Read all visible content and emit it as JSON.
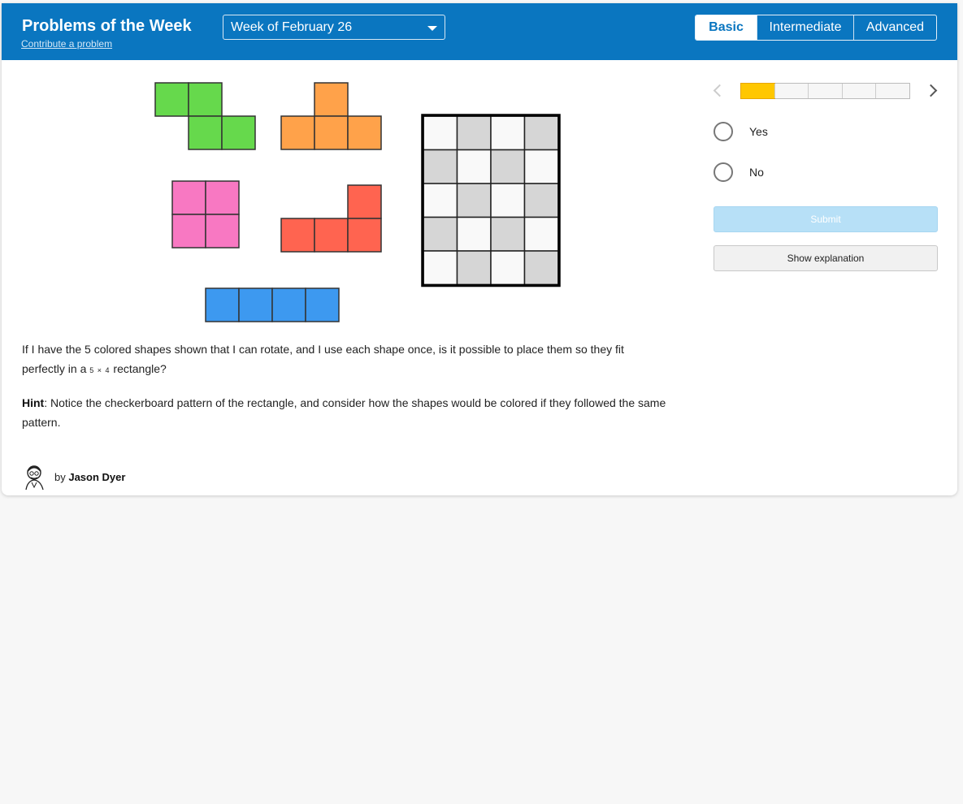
{
  "header": {
    "title": "Problems of the Week",
    "contribute_link": "Contribute a problem",
    "week_select": "Week of February 26",
    "levels": [
      {
        "label": "Basic",
        "active": true
      },
      {
        "label": "Intermediate",
        "active": false
      },
      {
        "label": "Advanced",
        "active": false
      }
    ]
  },
  "colors": {
    "header_bg": "#0a76c0",
    "green": "#66d94c",
    "orange": "#ffa24a",
    "pink": "#f878c2",
    "red": "#ff6450",
    "blue": "#3d99f0",
    "progress": "#ffc700"
  },
  "figure": {
    "shapes": [
      "green-s-tetromino",
      "orange-t-tetromino",
      "pink-square-tetromino",
      "red-l-tetromino",
      "blue-i-tetromino"
    ],
    "board": {
      "rows": 5,
      "cols": 4,
      "pattern": "checkerboard"
    }
  },
  "question": {
    "text_before": "If I have the 5 colored shapes shown that I can rotate, and I use each shape once, is it possible to place them so they fit perfectly in a ",
    "dims": "5 × 4",
    "text_after": " rectangle?"
  },
  "hint": {
    "label": "Hint",
    "text": ": Notice the checkerboard pattern of the rectangle, and consider how the shapes would be colored if they followed the same pattern."
  },
  "author": {
    "by": "by ",
    "name": "Jason Dyer"
  },
  "progress": {
    "segments": 5,
    "current": 1
  },
  "choices": [
    "Yes",
    "No"
  ],
  "buttons": {
    "submit": "Submit",
    "explanation": "Show explanation"
  }
}
